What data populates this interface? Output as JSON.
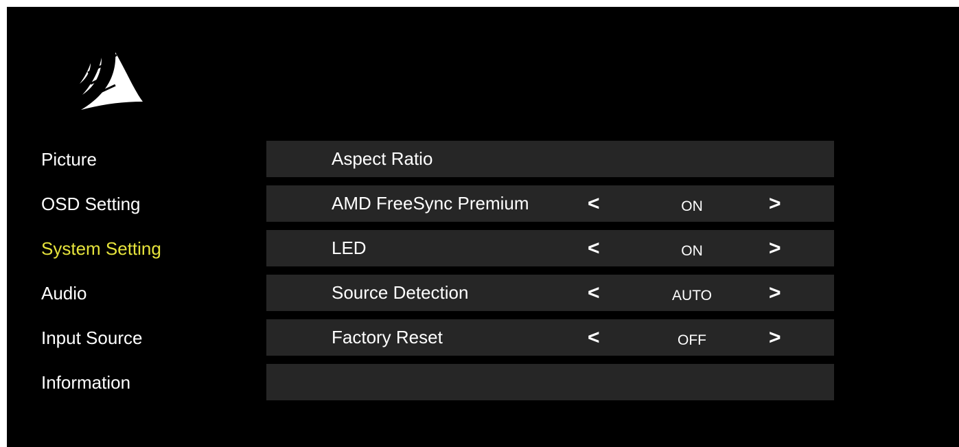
{
  "brand": {
    "logo_icon": "corsair-sails-icon"
  },
  "menu": {
    "items": [
      {
        "label": "Picture"
      },
      {
        "label": "OSD Setting"
      },
      {
        "label": "System Setting",
        "active": true
      },
      {
        "label": "Audio"
      },
      {
        "label": "Input Source"
      },
      {
        "label": "Information"
      }
    ],
    "active_color": "#e6e33c"
  },
  "settings": {
    "rows": [
      {
        "label": "Aspect Ratio"
      },
      {
        "label": "AMD FreeSync Premium",
        "value": "ON",
        "left_arrow": "<",
        "right_arrow": ">"
      },
      {
        "label": "LED",
        "value": "ON",
        "left_arrow": "<",
        "right_arrow": ">"
      },
      {
        "label": "Source Detection",
        "value": "AUTO",
        "left_arrow": "<",
        "right_arrow": ">"
      },
      {
        "label": "Factory Reset",
        "value": "OFF",
        "left_arrow": "<",
        "right_arrow": ">"
      },
      {
        "label": ""
      }
    ]
  },
  "colors": {
    "background": "#000000",
    "row_background": "#262626",
    "text": "#ffffff"
  }
}
